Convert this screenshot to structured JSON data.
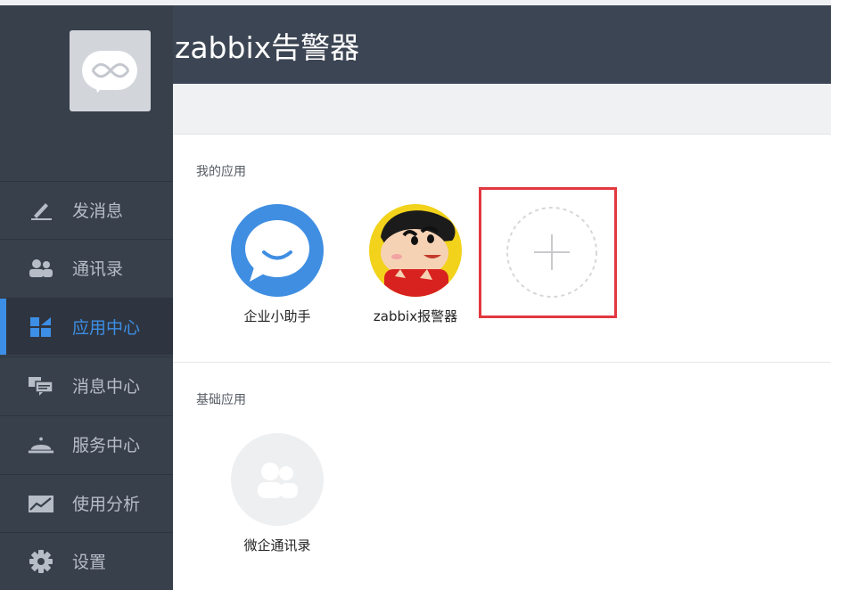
{
  "colors": {
    "sidebar": "#38404c",
    "header": "#3c4553",
    "accent": "#3d8ee6",
    "highlight_frame": "#e2383f"
  },
  "header": {
    "title": "zabbix告警器"
  },
  "sidebar": {
    "logo_icon": "infinity-chat-icon",
    "items": [
      {
        "label": "发消息",
        "icon": "pen-icon",
        "active": false
      },
      {
        "label": "通讯录",
        "icon": "contacts-icon",
        "active": false
      },
      {
        "label": "应用中心",
        "icon": "app-grid-icon",
        "active": true
      },
      {
        "label": "消息中心",
        "icon": "message-center-icon",
        "active": false
      },
      {
        "label": "服务中心",
        "icon": "service-bell-icon",
        "active": false
      },
      {
        "label": "使用分析",
        "icon": "chart-icon",
        "active": false
      },
      {
        "label": "设置",
        "icon": "gear-icon",
        "active": false
      }
    ]
  },
  "main": {
    "my_apps": {
      "title": "我的应用",
      "apps": [
        {
          "name": "企业小助手",
          "icon": "assistant-chat-icon"
        },
        {
          "name": "zabbix报警器",
          "icon": "cartoon-avatar-icon"
        }
      ],
      "add_icon": "plus-icon"
    },
    "basic_apps": {
      "title": "基础应用",
      "apps": [
        {
          "name": "微企通讯录",
          "icon": "people-icon"
        }
      ]
    }
  }
}
